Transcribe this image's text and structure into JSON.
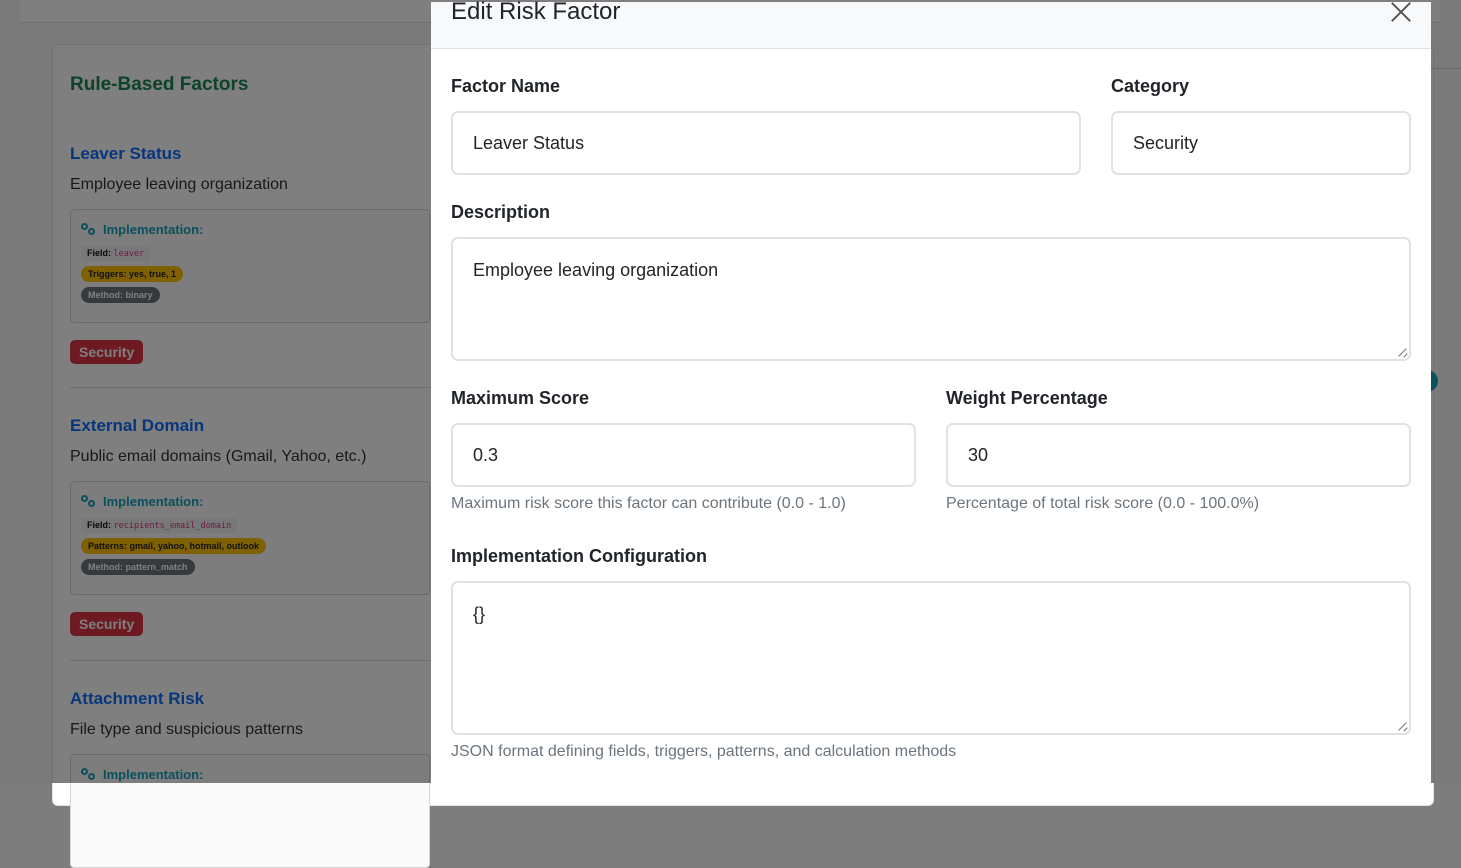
{
  "background": {
    "section_title": "Rule-Based Factors",
    "factors": [
      {
        "name": "Leaver Status",
        "description": "Employee leaving organization",
        "impl_title": "Implementation:",
        "field_label": "Field:",
        "field_value": "leaver",
        "trigger_tag": "Triggers: yes, true, 1",
        "method_tag": "Method: binary",
        "category": "Security"
      },
      {
        "name": "External Domain",
        "description": "Public email domains (Gmail, Yahoo, etc.)",
        "impl_title": "Implementation:",
        "field_label": "Field:",
        "field_value": "recipients_email_domain",
        "trigger_tag": "Patterns: gmail, yahoo, hotmail, outlook",
        "method_tag": "Method: pattern_match",
        "category": "Security"
      },
      {
        "name": "Attachment Risk",
        "description": "File type and suspicious patterns",
        "impl_title": "Implementation:"
      }
    ]
  },
  "modal": {
    "title": "Edit Risk Factor",
    "fields": {
      "factor_name": {
        "label": "Factor Name",
        "value": "Leaver Status"
      },
      "category": {
        "label": "Category",
        "value": "Security"
      },
      "description": {
        "label": "Description",
        "value": "Employee leaving organization"
      },
      "max_score": {
        "label": "Maximum Score",
        "value": "0.3",
        "hint": "Maximum risk score this factor can contribute (0.0 - 1.0)"
      },
      "weight": {
        "label": "Weight Percentage",
        "value": "30",
        "hint": "Percentage of total risk score (0.0 - 100.0%)"
      },
      "implementation": {
        "label": "Implementation Configuration",
        "value": "{}",
        "hint": "JSON format defining fields, triggers, patterns, and calculation methods"
      }
    }
  },
  "colors": {
    "section_title": "#198754",
    "factor_link": "#0d6efd",
    "impl_accent": "#17a2b8",
    "trigger_tag": "#ffc107",
    "method_tag": "#6c757d",
    "category_badge": "#dc3545"
  },
  "icons": {
    "implementation": "gears-icon",
    "close": "close-icon"
  }
}
